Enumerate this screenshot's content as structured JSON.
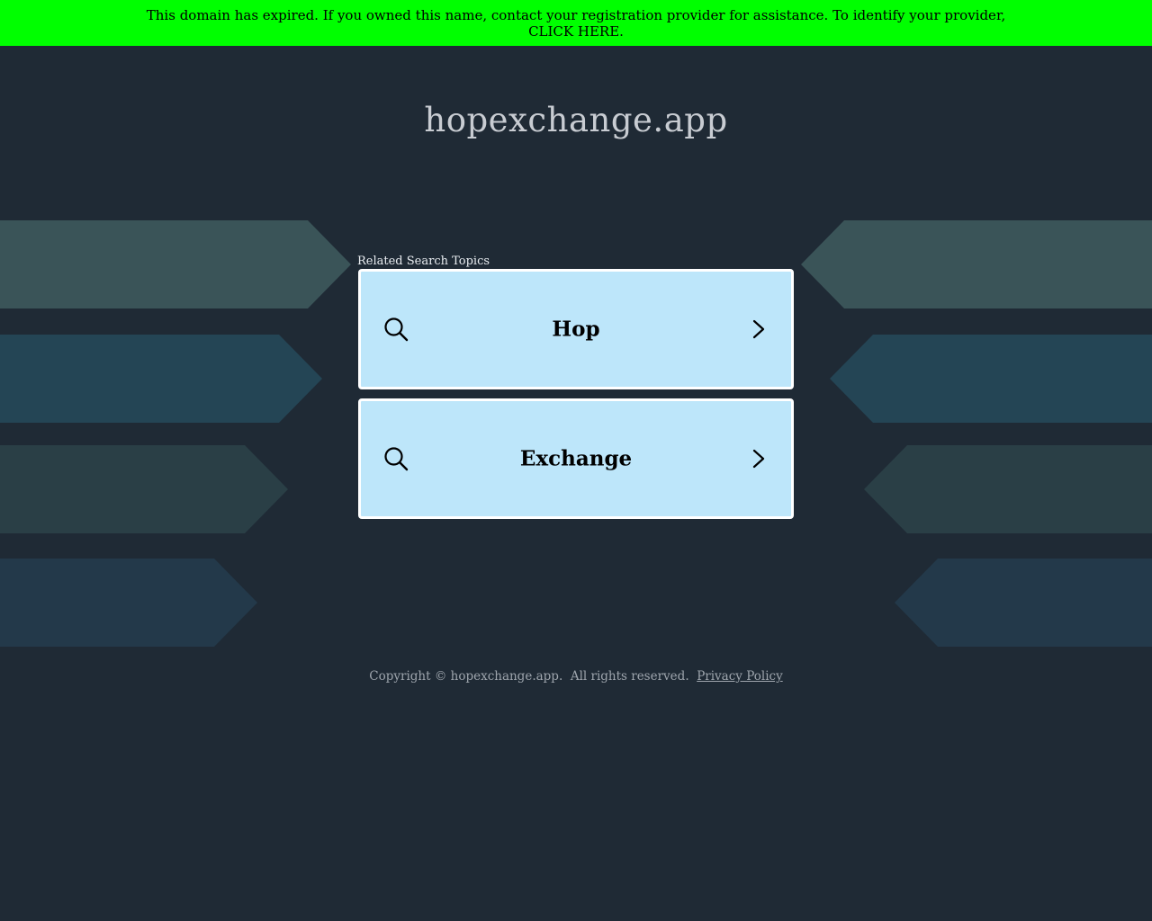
{
  "banner": {
    "message": "This domain has expired. If you owned this name, contact your registration provider for assistance. To identify your provider,",
    "link_label": "CLICK HERE",
    "link_suffix": "."
  },
  "header": {
    "domain": "hopexchange.app"
  },
  "related": {
    "heading": "Related Search Topics",
    "items": [
      {
        "label": "Hop"
      },
      {
        "label": "Exchange"
      }
    ]
  },
  "footer": {
    "copyright": "Copyright © hopexchange.app.  All rights reserved.",
    "privacy_label": "Privacy Policy"
  },
  "colors": {
    "banner_bg": "#00ff00",
    "page_bg": "#1f2a35",
    "card_bg": "#bde6fa",
    "card_border": "#ffffff"
  },
  "icons": {
    "search": "search-icon",
    "chevron": "chevron-right-icon"
  }
}
